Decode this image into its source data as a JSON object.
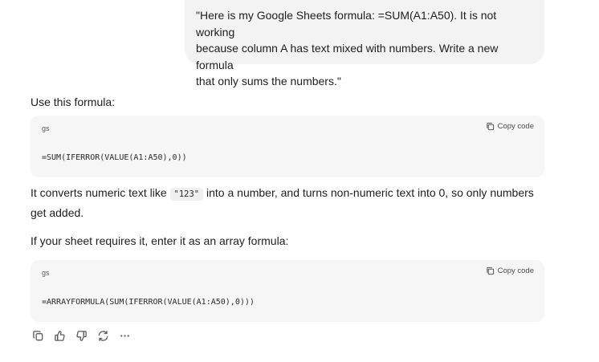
{
  "user_message": {
    "lines": [
      "\"Here is my Google Sheets formula: =SUM(A1:A50). It is not working",
      "because column A has text mixed with numbers. Write a new formula",
      "that only sums the numbers.\""
    ]
  },
  "assistant": {
    "intro": "Use this formula:",
    "code_blocks": [
      {
        "lang": "gs",
        "copy_label": "Copy code",
        "code": "=SUM(IFERROR(VALUE(A1:A50),0))"
      },
      {
        "lang": "gs",
        "copy_label": "Copy code",
        "code": "=ARRAYFORMULA(SUM(IFERROR(VALUE(A1:A50),0)))"
      }
    ],
    "explanation": {
      "before": "It converts numeric text like ",
      "inline_code": "\"123\"",
      "after": " into a number, and turns non-numeric text into 0, so only numbers get added."
    },
    "array_note": "If your sheet requires it, enter it as an array formula:"
  },
  "action_bar": {
    "icons": [
      "copy-icon",
      "thumbs-up-icon",
      "thumbs-down-icon",
      "regenerate-icon",
      "more-icon"
    ]
  },
  "colors": {
    "user_bubble_bg": "#f3f3f3",
    "code_block_bg": "#f6f6f6",
    "text": "#1e1e1e",
    "muted": "#5d5d5d"
  }
}
